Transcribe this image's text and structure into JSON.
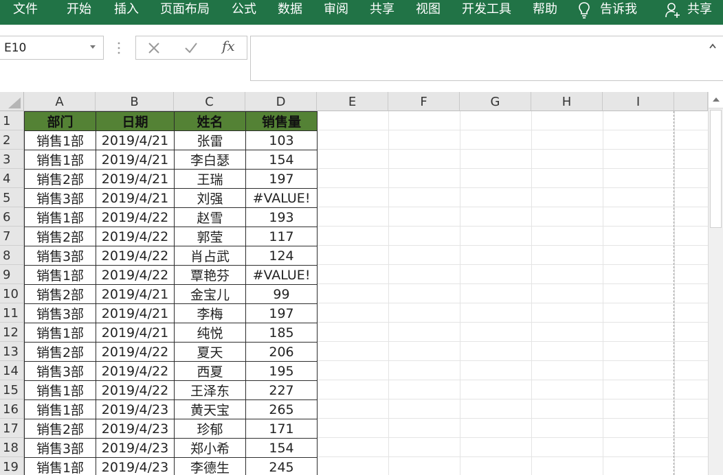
{
  "ribbon": {
    "tabs": [
      "文件",
      "开始",
      "插入",
      "页面布局",
      "公式",
      "数据",
      "审阅",
      "共享",
      "视图",
      "开发工具",
      "帮助"
    ],
    "tell_me": "告诉我",
    "share": "共享",
    "bg_color": "#217346"
  },
  "formula_bar": {
    "name_box": "E10",
    "cancel_icon": "close-icon",
    "enter_icon": "check-icon",
    "function_icon": "fx-icon",
    "function_label": "fx",
    "formula": ""
  },
  "grid": {
    "columns": [
      "A",
      "B",
      "C",
      "D",
      "E",
      "F",
      "G",
      "H",
      "I"
    ],
    "rows": [
      "1",
      "2",
      "3",
      "4",
      "5",
      "6",
      "7",
      "8",
      "9",
      "10",
      "11",
      "12",
      "13",
      "14",
      "15",
      "16",
      "17",
      "18",
      "19"
    ],
    "active_cell": "E10"
  },
  "table": {
    "header_color": "#548235",
    "headers": [
      "部门",
      "日期",
      "姓名",
      "销售量"
    ],
    "rows": [
      [
        "销售1部",
        "2019/4/21",
        "张雷",
        "103"
      ],
      [
        "销售1部",
        "2019/4/21",
        "李白瑟",
        "154"
      ],
      [
        "销售2部",
        "2019/4/21",
        "王瑞",
        "197"
      ],
      [
        "销售3部",
        "2019/4/21",
        "刘强",
        "#VALUE!"
      ],
      [
        "销售1部",
        "2019/4/22",
        "赵雪",
        "193"
      ],
      [
        "销售2部",
        "2019/4/22",
        "郭莹",
        "117"
      ],
      [
        "销售3部",
        "2019/4/22",
        "肖占武",
        "124"
      ],
      [
        "销售1部",
        "2019/4/22",
        "覃艳芬",
        "#VALUE!"
      ],
      [
        "销售2部",
        "2019/4/21",
        "金宝儿",
        "99"
      ],
      [
        "销售3部",
        "2019/4/21",
        "李梅",
        "197"
      ],
      [
        "销售1部",
        "2019/4/21",
        "纯悦",
        "185"
      ],
      [
        "销售2部",
        "2019/4/22",
        "夏天",
        "206"
      ],
      [
        "销售3部",
        "2019/4/22",
        "西夏",
        "195"
      ],
      [
        "销售1部",
        "2019/4/22",
        "王泽东",
        "227"
      ],
      [
        "销售1部",
        "2019/4/23",
        "黄天宝",
        "265"
      ],
      [
        "销售2部",
        "2019/4/23",
        "珍郁",
        "171"
      ],
      [
        "销售3部",
        "2019/4/23",
        "郑小希",
        "154"
      ],
      [
        "销售1部",
        "2019/4/23",
        "李德生",
        "245"
      ]
    ]
  }
}
